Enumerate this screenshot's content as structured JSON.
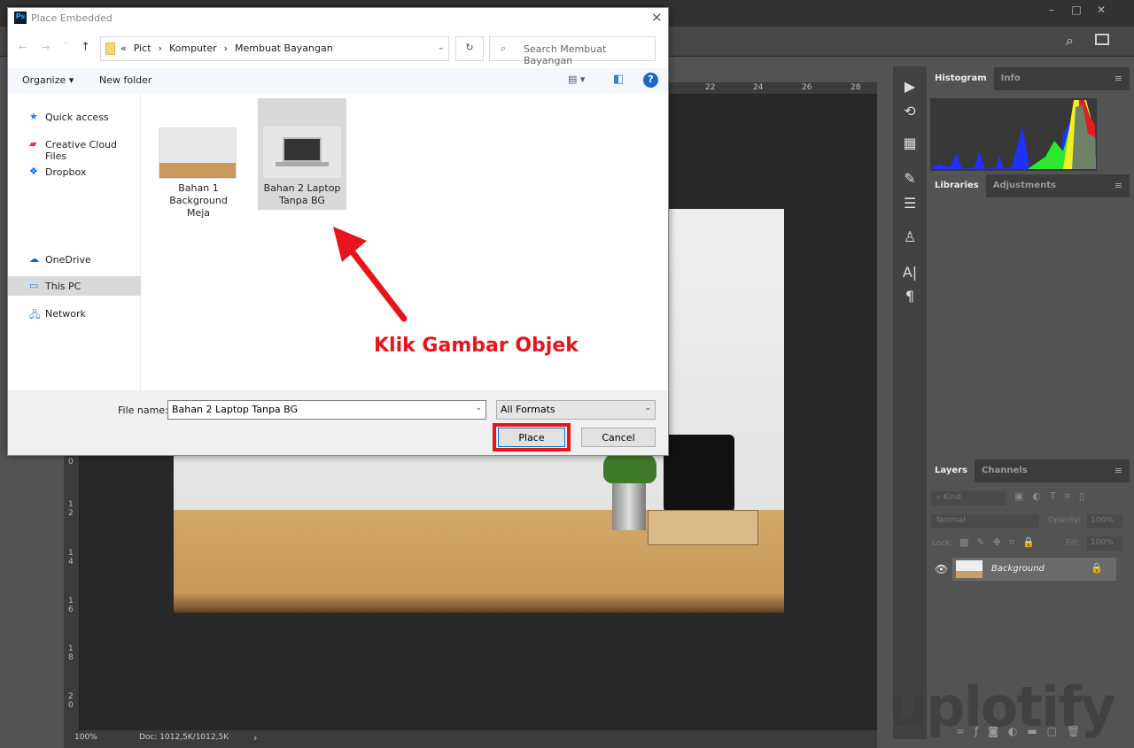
{
  "photoshop": {
    "window_controls": [
      "–",
      "□",
      "✕"
    ],
    "ruler_top": [
      "22",
      "24",
      "26",
      "28"
    ],
    "ruler_left": [
      "0",
      "1 2",
      "1 4",
      "1 6",
      "1 8",
      "2 0"
    ],
    "status": {
      "zoom": "100%",
      "doc": "Doc: 1012,5K/1012,5K",
      "arrow": "›"
    },
    "histogram_panel": {
      "tabs": [
        "Histogram",
        "Info"
      ]
    },
    "libraries_panel": {
      "tabs": [
        "Libraries",
        "Adjustments"
      ]
    },
    "layers_panel": {
      "tabs": [
        "Layers",
        "Channels"
      ],
      "filter_placeholder": "Kind",
      "blend_mode": "Normal",
      "opacity_label": "Opacity:",
      "opacity": "100%",
      "lock_label": "Lock:",
      "fill_label": "Fill:",
      "fill": "100%",
      "layers": [
        {
          "name": "Background",
          "visible": true,
          "locked": true
        }
      ]
    },
    "tools": [
      "play-icon",
      "history-icon",
      "properties-icon",
      "brushes-icon",
      "brush-settings-icon",
      "clone-source-icon",
      "character-icon",
      "paragraph-icon"
    ]
  },
  "dialog": {
    "title": "Place Embedded",
    "app_badge": "Ps",
    "breadcrumb": [
      "«",
      "Pict",
      "›",
      "Komputer",
      "›",
      "Membuat Bayangan"
    ],
    "search_placeholder": "Search Membuat Bayangan",
    "toolbar": {
      "organize": "Organize ▾",
      "new_folder": "New folder",
      "help": "?"
    },
    "nav": [
      {
        "label": "Quick access",
        "icon": "star-icon"
      },
      {
        "label": "Creative Cloud Files",
        "icon": "creative-cloud-icon"
      },
      {
        "label": "Dropbox",
        "icon": "dropbox-icon"
      },
      {
        "label": "OneDrive",
        "icon": "onedrive-icon"
      },
      {
        "label": "This PC",
        "icon": "computer-icon",
        "selected": true
      },
      {
        "label": "Network",
        "icon": "network-icon"
      }
    ],
    "files": [
      {
        "name": "Bahan 1 Background Meja",
        "lines": [
          "Bahan 1",
          "Background",
          "Meja"
        ]
      },
      {
        "name": "Bahan 2 Laptop Tanpa BG",
        "lines": [
          "Bahan 2 Laptop",
          "Tanpa BG"
        ],
        "selected": true
      }
    ],
    "file_name_label": "File name:",
    "file_name": "Bahan 2 Laptop Tanpa BG",
    "format": "All Formats",
    "place": "Place",
    "cancel": "Cancel"
  },
  "annotation": {
    "text": "Klik Gambar Objek",
    "color": "#e8141c"
  },
  "watermark": "uplotify",
  "colors": {
    "ps_bg": "#535353",
    "canvas": "#282828",
    "highlight": "#e8141c",
    "selection": "#d9d9d9"
  }
}
